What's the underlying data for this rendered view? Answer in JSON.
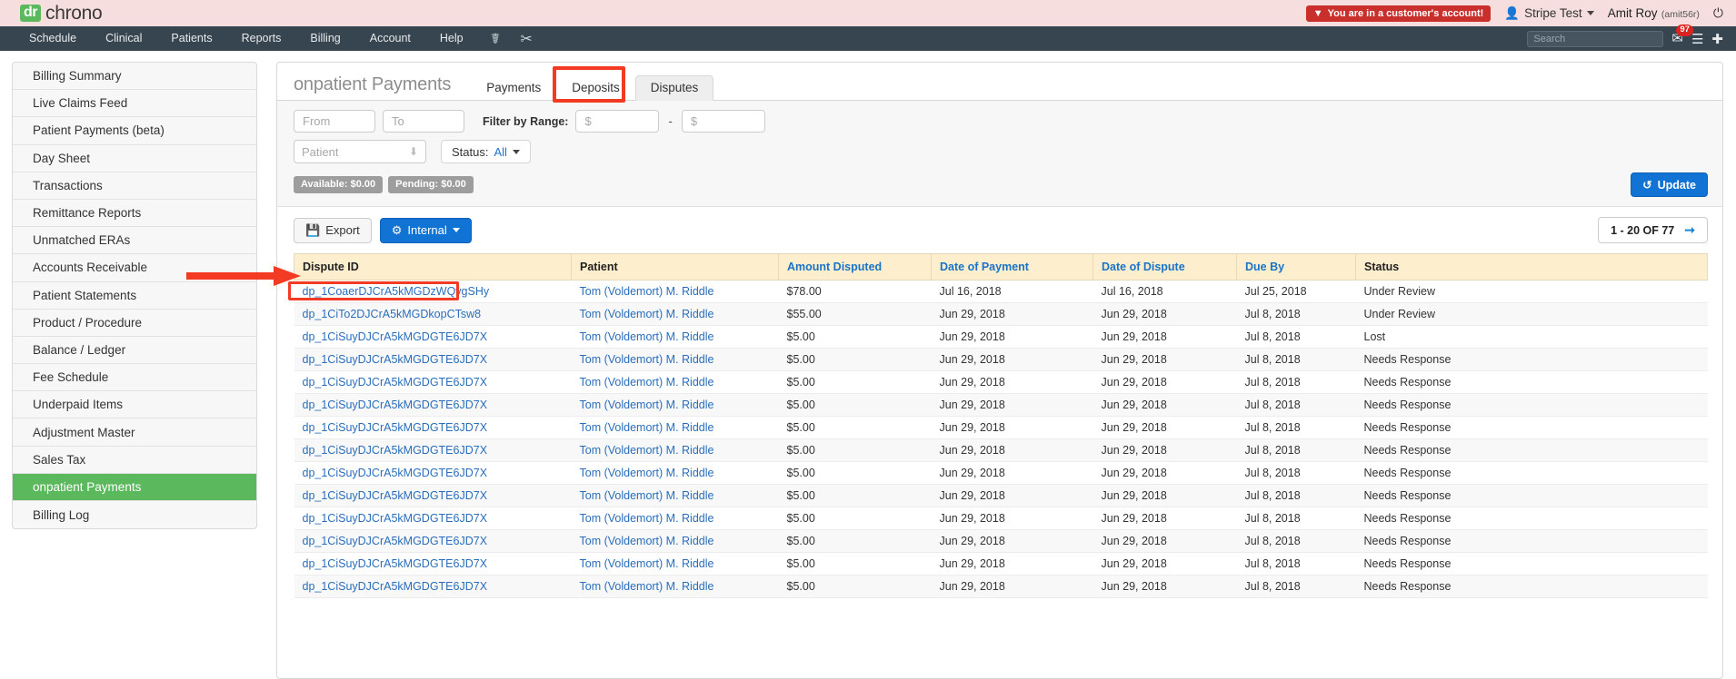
{
  "topbar": {
    "brand_badge": "dr",
    "brand_name": "chrono",
    "customer_alert": "You are in a customer's account!",
    "alert_icon": "filter-icon",
    "account_switcher": "Stripe Test",
    "account_icon": "user-icon",
    "user_name": "Amit Roy",
    "user_handle": "(amit56r)",
    "power_icon": "power-icon"
  },
  "nav": {
    "items": [
      {
        "label": "Schedule"
      },
      {
        "label": "Clinical"
      },
      {
        "label": "Patients"
      },
      {
        "label": "Reports"
      },
      {
        "label": "Billing"
      },
      {
        "label": "Account"
      },
      {
        "label": "Help"
      }
    ],
    "icons": [
      "caduceus-icon",
      "scissors-icon"
    ],
    "search_placeholder": "Search",
    "search_value": "",
    "message_count": "97",
    "message_icon": "envelope-icon",
    "menu_icon": "hamburger-icon",
    "add_icon": "plus-icon"
  },
  "sidebar": {
    "items": [
      {
        "label": "Billing Summary",
        "active": false
      },
      {
        "label": "Live Claims Feed",
        "active": false
      },
      {
        "label": "Patient Payments (beta)",
        "active": false
      },
      {
        "label": "Day Sheet",
        "active": false
      },
      {
        "label": "Transactions",
        "active": false
      },
      {
        "label": "Remittance Reports",
        "active": false
      },
      {
        "label": "Unmatched ERAs",
        "active": false
      },
      {
        "label": "Accounts Receivable",
        "active": false
      },
      {
        "label": "Patient Statements",
        "active": false
      },
      {
        "label": "Product / Procedure",
        "active": false
      },
      {
        "label": "Balance / Ledger",
        "active": false
      },
      {
        "label": "Fee Schedule",
        "active": false
      },
      {
        "label": "Underpaid Items",
        "active": false
      },
      {
        "label": "Adjustment Master",
        "active": false
      },
      {
        "label": "Sales Tax",
        "active": false
      },
      {
        "label": "onpatient Payments",
        "active": true
      },
      {
        "label": "Billing Log",
        "active": false
      }
    ]
  },
  "panel": {
    "title": "onpatient Payments",
    "tabs": [
      {
        "label": "Payments",
        "selected": false
      },
      {
        "label": "Deposits",
        "selected": false
      },
      {
        "label": "Disputes",
        "selected": true
      }
    ]
  },
  "filters": {
    "from_placeholder": "From",
    "from_value": "",
    "to_placeholder": "To",
    "to_value": "",
    "range_label": "Filter by Range:",
    "range_min_placeholder": "$",
    "range_min_value": "",
    "range_dash": "-",
    "range_max_placeholder": "$",
    "range_max_value": "",
    "patient_placeholder": "Patient",
    "status_label": "Status:",
    "status_value": "All",
    "available_badge": "Available: $0.00",
    "pending_badge": "Pending: $0.00",
    "update_label": "Update",
    "update_icon": "refresh-icon"
  },
  "toolbar": {
    "export_label": "Export",
    "export_icon": "save-icon",
    "internal_label": "Internal",
    "internal_icon": "gear-icon",
    "pager_text": "1 - 20 OF 77",
    "pager_arrow_icon": "arrow-right-icon"
  },
  "table": {
    "columns": [
      {
        "label": "Dispute ID",
        "sortable": false
      },
      {
        "label": "Patient",
        "sortable": false
      },
      {
        "label": "Amount Disputed",
        "sortable": true
      },
      {
        "label": "Date of Payment",
        "sortable": true
      },
      {
        "label": "Date of Dispute",
        "sortable": true
      },
      {
        "label": "Due By",
        "sortable": true
      },
      {
        "label": "Status",
        "sortable": false
      }
    ],
    "rows": [
      {
        "dispute_id": "dp_1CoaerDJCrA5kMGDzWQvgSHy",
        "patient": "Tom (Voldemort) M. Riddle",
        "amount": "$78.00",
        "date_of_payment": "Jul 16, 2018",
        "date_of_dispute": "Jul 16, 2018",
        "due_by": "Jul 25, 2018",
        "status": "Under Review"
      },
      {
        "dispute_id": "dp_1CiTo2DJCrA5kMGDkopCTsw8",
        "patient": "Tom (Voldemort) M. Riddle",
        "amount": "$55.00",
        "date_of_payment": "Jun 29, 2018",
        "date_of_dispute": "Jun 29, 2018",
        "due_by": "Jul 8, 2018",
        "status": "Under Review"
      },
      {
        "dispute_id": "dp_1CiSuyDJCrA5kMGDGTE6JD7X",
        "patient": "Tom (Voldemort) M. Riddle",
        "amount": "$5.00",
        "date_of_payment": "Jun 29, 2018",
        "date_of_dispute": "Jun 29, 2018",
        "due_by": "Jul 8, 2018",
        "status": "Lost"
      },
      {
        "dispute_id": "dp_1CiSuyDJCrA5kMGDGTE6JD7X",
        "patient": "Tom (Voldemort) M. Riddle",
        "amount": "$5.00",
        "date_of_payment": "Jun 29, 2018",
        "date_of_dispute": "Jun 29, 2018",
        "due_by": "Jul 8, 2018",
        "status": "Needs Response"
      },
      {
        "dispute_id": "dp_1CiSuyDJCrA5kMGDGTE6JD7X",
        "patient": "Tom (Voldemort) M. Riddle",
        "amount": "$5.00",
        "date_of_payment": "Jun 29, 2018",
        "date_of_dispute": "Jun 29, 2018",
        "due_by": "Jul 8, 2018",
        "status": "Needs Response"
      },
      {
        "dispute_id": "dp_1CiSuyDJCrA5kMGDGTE6JD7X",
        "patient": "Tom (Voldemort) M. Riddle",
        "amount": "$5.00",
        "date_of_payment": "Jun 29, 2018",
        "date_of_dispute": "Jun 29, 2018",
        "due_by": "Jul 8, 2018",
        "status": "Needs Response"
      },
      {
        "dispute_id": "dp_1CiSuyDJCrA5kMGDGTE6JD7X",
        "patient": "Tom (Voldemort) M. Riddle",
        "amount": "$5.00",
        "date_of_payment": "Jun 29, 2018",
        "date_of_dispute": "Jun 29, 2018",
        "due_by": "Jul 8, 2018",
        "status": "Needs Response"
      },
      {
        "dispute_id": "dp_1CiSuyDJCrA5kMGDGTE6JD7X",
        "patient": "Tom (Voldemort) M. Riddle",
        "amount": "$5.00",
        "date_of_payment": "Jun 29, 2018",
        "date_of_dispute": "Jun 29, 2018",
        "due_by": "Jul 8, 2018",
        "status": "Needs Response"
      },
      {
        "dispute_id": "dp_1CiSuyDJCrA5kMGDGTE6JD7X",
        "patient": "Tom (Voldemort) M. Riddle",
        "amount": "$5.00",
        "date_of_payment": "Jun 29, 2018",
        "date_of_dispute": "Jun 29, 2018",
        "due_by": "Jul 8, 2018",
        "status": "Needs Response"
      },
      {
        "dispute_id": "dp_1CiSuyDJCrA5kMGDGTE6JD7X",
        "patient": "Tom (Voldemort) M. Riddle",
        "amount": "$5.00",
        "date_of_payment": "Jun 29, 2018",
        "date_of_dispute": "Jun 29, 2018",
        "due_by": "Jul 8, 2018",
        "status": "Needs Response"
      },
      {
        "dispute_id": "dp_1CiSuyDJCrA5kMGDGTE6JD7X",
        "patient": "Tom (Voldemort) M. Riddle",
        "amount": "$5.00",
        "date_of_payment": "Jun 29, 2018",
        "date_of_dispute": "Jun 29, 2018",
        "due_by": "Jul 8, 2018",
        "status": "Needs Response"
      },
      {
        "dispute_id": "dp_1CiSuyDJCrA5kMGDGTE6JD7X",
        "patient": "Tom (Voldemort) M. Riddle",
        "amount": "$5.00",
        "date_of_payment": "Jun 29, 2018",
        "date_of_dispute": "Jun 29, 2018",
        "due_by": "Jul 8, 2018",
        "status": "Needs Response"
      },
      {
        "dispute_id": "dp_1CiSuyDJCrA5kMGDGTE6JD7X",
        "patient": "Tom (Voldemort) M. Riddle",
        "amount": "$5.00",
        "date_of_payment": "Jun 29, 2018",
        "date_of_dispute": "Jun 29, 2018",
        "due_by": "Jul 8, 2018",
        "status": "Needs Response"
      },
      {
        "dispute_id": "dp_1CiSuyDJCrA5kMGDGTE6JD7X",
        "patient": "Tom (Voldemort) M. Riddle",
        "amount": "$5.00",
        "date_of_payment": "Jun 29, 2018",
        "date_of_dispute": "Jun 29, 2018",
        "due_by": "Jul 8, 2018",
        "status": "Needs Response"
      }
    ]
  },
  "annotations": {
    "accent_red": "#f33a22",
    "highlight_tab": "Disputes",
    "highlight_cell": "dp_1CoaerDJCrA5kMGDzWQvgSHy"
  }
}
